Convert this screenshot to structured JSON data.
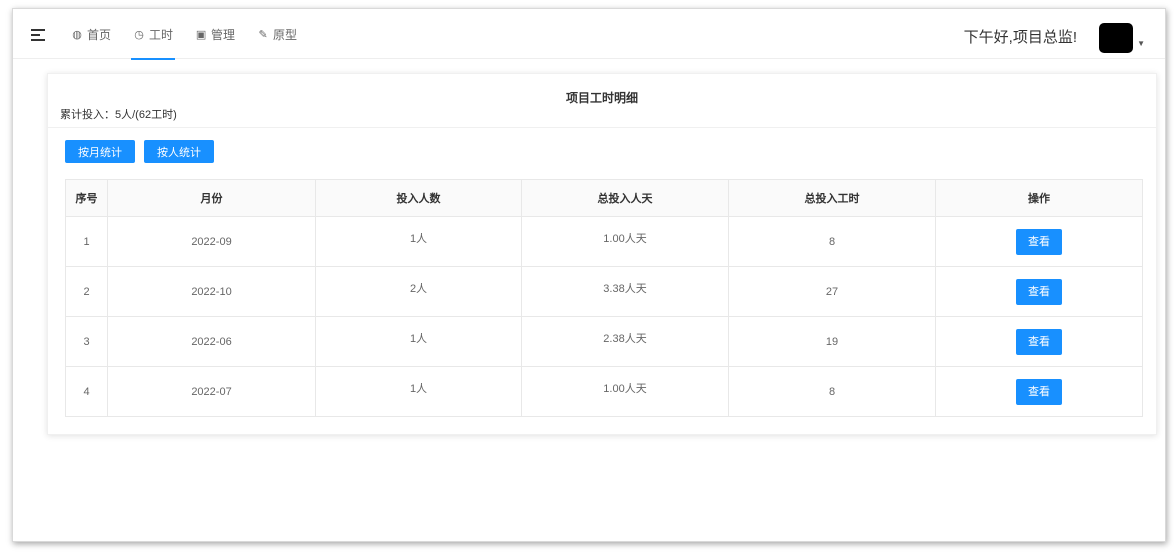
{
  "header": {
    "nav": [
      {
        "icon": "dashboard-icon",
        "glyph": "◍",
        "label": "首页"
      },
      {
        "icon": "clock-icon",
        "glyph": "◷",
        "label": "工时",
        "active": true
      },
      {
        "icon": "manage-icon",
        "glyph": "▣",
        "label": "管理"
      },
      {
        "icon": "edit-icon",
        "glyph": "✎",
        "label": "原型"
      }
    ],
    "greeting": "下午好,项目总监!"
  },
  "card": {
    "title": "项目工时明细",
    "summary": "累计投入：5人/(62工时)",
    "buttons": {
      "by_month": "按月统计",
      "by_person": "按人统计"
    }
  },
  "table": {
    "columns": [
      "序号",
      "月份",
      "投入人数",
      "总投入人天",
      "总投入工时",
      "操作"
    ],
    "rows": [
      {
        "no": "1",
        "month": "2022-09",
        "people": "1人",
        "days": "1.00人天",
        "hours": "8",
        "action": "查看"
      },
      {
        "no": "2",
        "month": "2022-10",
        "people": "2人",
        "days": "3.38人天",
        "hours": "27",
        "action": "查看"
      },
      {
        "no": "3",
        "month": "2022-06",
        "people": "1人",
        "days": "2.38人天",
        "hours": "19",
        "action": "查看"
      },
      {
        "no": "4",
        "month": "2022-07",
        "people": "1人",
        "days": "1.00人天",
        "hours": "8",
        "action": "查看"
      }
    ]
  },
  "colors": {
    "accent": "#1890ff"
  }
}
